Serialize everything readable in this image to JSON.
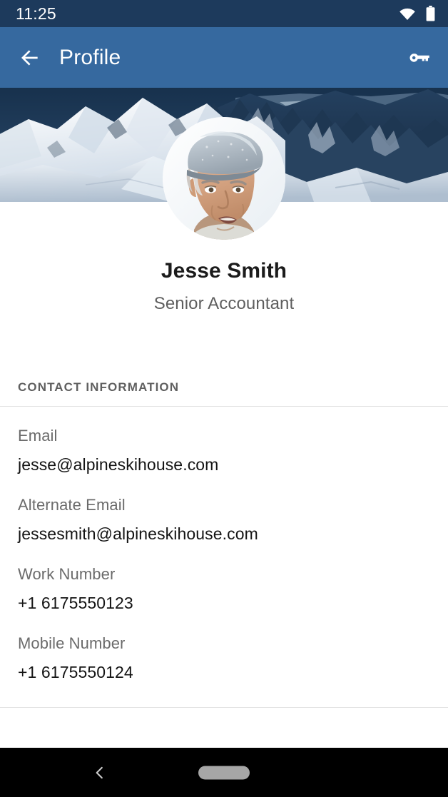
{
  "status_bar": {
    "time": "11:25",
    "icons": [
      "wifi-icon",
      "battery-icon"
    ],
    "background": "#1d3a5c",
    "foreground": "#ffffff"
  },
  "app_bar": {
    "title": "Profile",
    "back_icon": "arrow-back-icon",
    "action_icon": "key-icon",
    "background": "#36699f",
    "foreground": "#ffffff"
  },
  "banner": {
    "description": "snow covered mountain peaks",
    "sky_color": "#1d3a58",
    "snow_color": "#f4f7fb",
    "rock_color": "#2c4561"
  },
  "avatar": {
    "description": "portrait of an older man wearing a grey flat cap"
  },
  "identity": {
    "name": "Jesse Smith",
    "job_title": "Senior Accountant"
  },
  "contact_section": {
    "header": "CONTACT INFORMATION",
    "fields": [
      {
        "label": "Email",
        "value": "jesse@alpineskihouse.com"
      },
      {
        "label": "Alternate Email",
        "value": "jessesmith@alpineskihouse.com"
      },
      {
        "label": "Work Number",
        "value": "+1 6175550123"
      },
      {
        "label": "Mobile Number",
        "value": "+1 6175550124"
      }
    ]
  },
  "nav_bar": {
    "back_icon": "nav-back-icon",
    "home_icon": "nav-home-pill",
    "background": "#000000"
  }
}
